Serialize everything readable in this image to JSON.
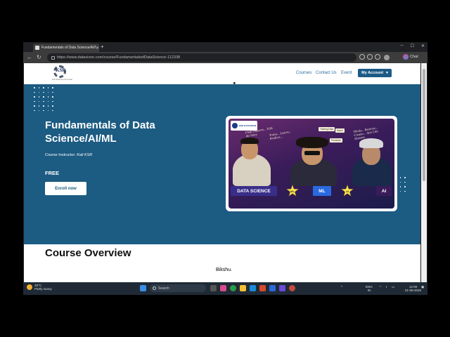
{
  "browser": {
    "tab_title": "Fundamentals of Data Science/AI/M",
    "url": "https://www.datavizon.com/course/FundamentalsofDataScience-112338",
    "copilot_label": "Chat"
  },
  "site": {
    "logo_text": "KSR",
    "logo_tagline": "Your Success is Our Goal",
    "nav": {
      "courses": "Courses",
      "contact": "Contact Us",
      "event": "Event",
      "account": "My Account"
    }
  },
  "hero": {
    "title": "Fundamentals of Data Science/AI/ML",
    "instructor_label": "Course Instructor:",
    "instructor_name": "Kali KSR",
    "price": "FREE",
    "enroll_label": "Enroll now"
  },
  "banner": {
    "brand": "KSR DATAVIZON",
    "thought_left": "Finds Patterns... Tells the Story",
    "thought_mid": "Trains... Learns... Predicts...",
    "thought_right": "Thinks... Reasons... Creates... Acts Like Humans",
    "note1": "Training Data",
    "note2": "Model",
    "note3": "Prediction",
    "tag_ds": "DATA SCIENCE",
    "tag_ml": "ML",
    "tag_ai": "AI",
    "star1": "ML",
    "star2": "AI",
    "tag_colors": {
      "ds": "#3a2e8a",
      "ml": "#2a6ae0",
      "ai": "#3a1c5a"
    }
  },
  "main": {
    "section_title": "Course Overview"
  },
  "overlay": {
    "watermark": "Bikshu."
  },
  "taskbar": {
    "temp": "28°C",
    "weather": "Partly sunny",
    "search": "Search",
    "lang1": "ENG",
    "lang2": "IN",
    "time": "12:09",
    "date": "01-08-2025"
  }
}
